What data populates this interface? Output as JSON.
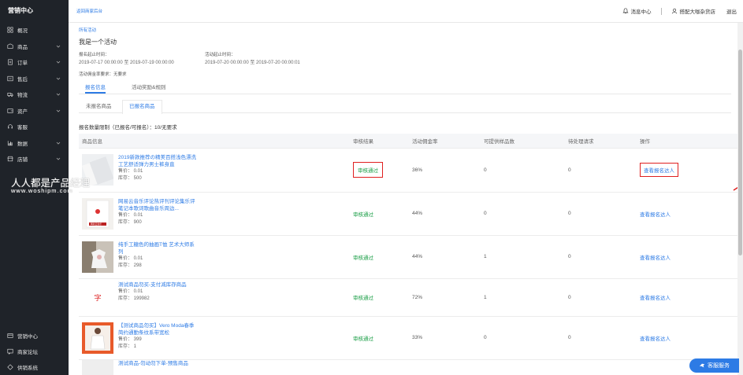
{
  "sidebar": {
    "title": "营销中心",
    "items": [
      {
        "label": "概况",
        "icon": "overview-icon",
        "has_children": false
      },
      {
        "label": "商品",
        "icon": "product-icon",
        "has_children": true
      },
      {
        "label": "订单",
        "icon": "order-icon",
        "has_children": true
      },
      {
        "label": "售后",
        "icon": "after-sales-icon",
        "has_children": true
      },
      {
        "label": "物流",
        "icon": "truck-icon",
        "has_children": true
      },
      {
        "label": "资产",
        "icon": "wallet-icon",
        "has_children": true
      },
      {
        "label": "客服",
        "icon": "headset-icon",
        "has_children": false
      },
      {
        "label": "数据",
        "icon": "chart-icon",
        "has_children": true
      },
      {
        "label": "店铺",
        "icon": "store-icon",
        "has_children": true
      }
    ],
    "bottom_items": [
      {
        "label": "营销中心",
        "icon": "marketing-icon"
      },
      {
        "label": "商家论坛",
        "icon": "forum-icon"
      },
      {
        "label": "供销系统",
        "icon": "supply-icon"
      }
    ]
  },
  "header": {
    "back_link": "返回商家后台",
    "messages": "消息中心",
    "account": "搭配大咖杂货店",
    "logout": "退出"
  },
  "page": {
    "breadcrumb": "所有活动",
    "title": "我是一个活动",
    "signup_deadline_label": "报名起止时间：",
    "signup_deadline_value": "2019-07-17 00:00:00 至 2019-07-19 00:00:00",
    "activity_period_label": "活动起止时间：",
    "activity_period_value": "2019-07-20 00:00:00 至 2019-07-20 00:00:01",
    "deposit_label": "活动佣金率要求：无要求",
    "tabs": [
      "报名信息",
      "活动奖励&规则"
    ],
    "subtabs": [
      "未报名商品",
      "已报名商品"
    ],
    "quota_text": "报名数量限制（已报名/可报名）：10/无要求"
  },
  "table": {
    "headers": [
      "商品信息",
      "审核结果",
      "活动佣金率",
      "可提供样品数",
      "待处理请求",
      "操作"
    ],
    "rows": [
      {
        "name": "2019新款推荐の精美百搭浅色漂洗工艺舒适弹力男士裤身直",
        "price": "售价：  0.01",
        "stock": "库存：  500",
        "status": "审核通过",
        "commission": "36%",
        "samples": "0",
        "pending": "0",
        "action": "查看报名达人"
      },
      {
        "name": "网易云音乐评论热评刊评论集乐评笔记本歌词歌曲音乐周边...",
        "price": "售价：  0.01",
        "stock": "库存：  900",
        "status": "审核通过",
        "commission": "44%",
        "samples": "0",
        "pending": "0",
        "action": "查看报名达人"
      },
      {
        "name": "纯手工糖色的抽画T恤 艺术大师系列",
        "price": "售价：  0.01",
        "stock": "库存：  298",
        "status": "审核通过",
        "commission": "44%",
        "samples": "1",
        "pending": "0",
        "action": "查看报名达人"
      },
      {
        "name": "测试商品勿买-支付减库存商品",
        "price": "售价：  0.01",
        "stock": "库存：  199982",
        "status": "审核通过",
        "commission": "72%",
        "samples": "1",
        "pending": "0",
        "action": "查看报名达人"
      },
      {
        "name": "【测试商品勿买】Vero Moda春季简约通勤条纹系带宽松",
        "price": "售价：  399",
        "stock": "库存：  1",
        "status": "审核通过",
        "commission": "33%",
        "samples": "0",
        "pending": "0",
        "action": "查看报名达人"
      },
      {
        "name": "测试商品-勿动勿下单-预售商品",
        "price": "",
        "stock": "",
        "status": "",
        "commission": "",
        "samples": "",
        "pending": "",
        "action": ""
      }
    ]
  },
  "thumb_text": {
    "row2": "网易云音乐",
    "row4": "字"
  },
  "watermark": {
    "line1": "人人都是产品经理",
    "line2": "www.woshipm.com"
  },
  "customer_service": "客服服务",
  "colors": {
    "sidebar_bg": "#1f2329",
    "link": "#2d7be5",
    "pass": "#1a9e46",
    "highlight": "#e02020"
  }
}
